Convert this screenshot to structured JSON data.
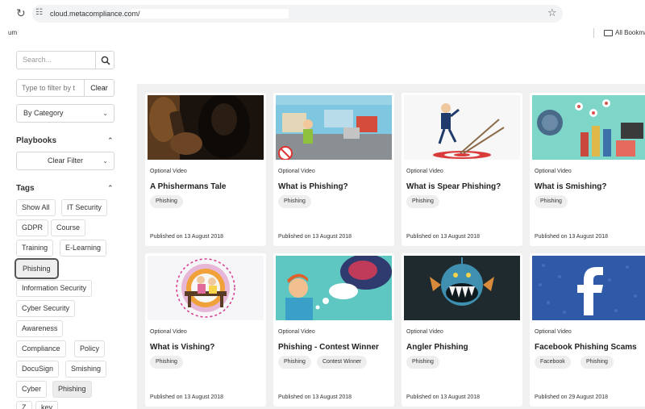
{
  "browser": {
    "url": "cloud.metacompliance.com/",
    "bookmarks_left": "um",
    "bookmarks_right": "All Bookmar"
  },
  "sidebar": {
    "search_placeholder": "Search...",
    "filter_placeholder": "Type to filter by t",
    "clear_label": "Clear",
    "category_select": "By Category",
    "playbooks_title": "Playbooks",
    "playbooks_select": "Clear Filter",
    "tags_title": "Tags",
    "tags": [
      "Show All",
      "IT Security",
      "GDPR",
      "Course",
      "Training",
      "E-Learning",
      "Phishing",
      "Information Security",
      "Cyber Security",
      "Awareness",
      "Compliance",
      "Policy",
      "DocuSign",
      "Smishing",
      "Cyber",
      "Phishing",
      "Z",
      "key"
    ]
  },
  "cards": [
    {
      "type": "Optional Video",
      "title": "A Phishermans Tale",
      "tags": [
        "Phishing"
      ],
      "published": "Published on 13 August 2018"
    },
    {
      "type": "Optional Video",
      "title": "What is Phishing?",
      "tags": [
        "Phishing"
      ],
      "published": "Published on 13 August 2018"
    },
    {
      "type": "Optional Video",
      "title": "What is Spear Phishing?",
      "tags": [
        "Phishing"
      ],
      "published": "Published on 13 August 2018"
    },
    {
      "type": "Optional Video",
      "title": "What is Smishing?",
      "tags": [
        "Phishing"
      ],
      "published": "Published on 13 August 2018"
    },
    {
      "type": "Optional Video",
      "title": "What is Vishing?",
      "tags": [
        "Phishing"
      ],
      "published": "Published on 13 August 2018"
    },
    {
      "type": "Optional Video",
      "title": "Phishing - Contest Winner",
      "tags": [
        "Phishing",
        "Contest Winner"
      ],
      "published": "Published on 13 August 2018"
    },
    {
      "type": "Optional Video",
      "title": "Angler Phishing",
      "tags": [
        "Phishing"
      ],
      "published": "Published on 13 August 2018"
    },
    {
      "type": "Optional Video",
      "title": "Facebook Phishing Scams",
      "tags": [
        "Facebook",
        "Phishing"
      ],
      "published": "Published on 29 August 2018"
    }
  ],
  "colors": {
    "content_bg": "#f0f0f0",
    "pill_bg": "#eeeeee",
    "facebook_blue": "#2f5aa8"
  }
}
